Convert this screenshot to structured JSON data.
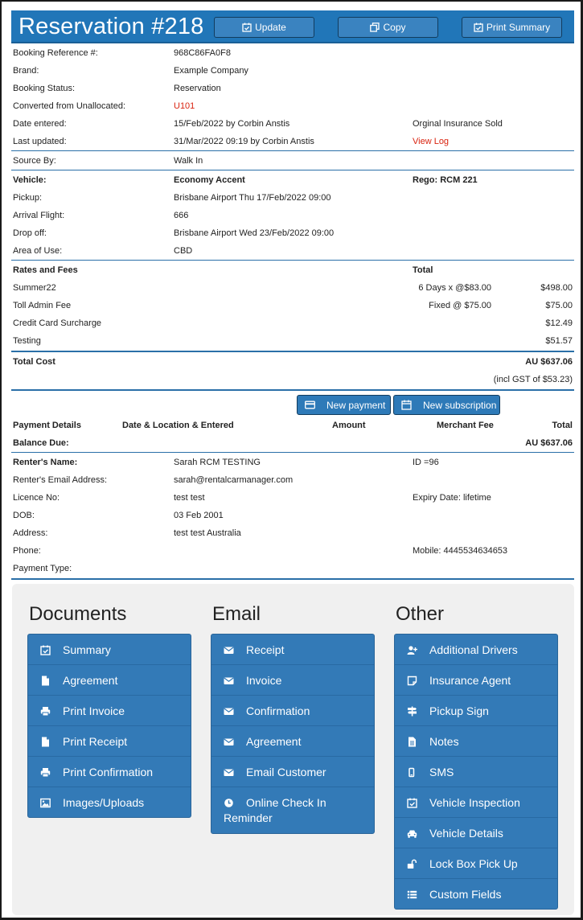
{
  "header": {
    "title": "Reservation #218",
    "update_label": "Update",
    "copy_label": "Copy",
    "print_summary_label": "Print Summary"
  },
  "booking": {
    "reference_label": "Booking Reference #:",
    "reference_value": "968C86FA0F8",
    "brand_label": "Brand:",
    "brand_value": "Example Company",
    "status_label": "Booking Status:",
    "status_value": "Reservation",
    "converted_label": "Converted from Unallocated:",
    "converted_value": "U101",
    "entered_label": "Date entered:",
    "entered_value": "15/Feb/2022 by Corbin Anstis",
    "insurance_note": "Orginal Insurance Sold",
    "updated_label": "Last updated:",
    "updated_value": "31/Mar/2022 09:19 by Corbin Anstis",
    "view_log": "View Log",
    "source_label": "Source By:",
    "source_value": "Walk In"
  },
  "vehicle": {
    "vehicle_label": "Vehicle:",
    "vehicle_value": "Economy Accent",
    "rego": "Rego: RCM 221",
    "pickup_label": "Pickup:",
    "pickup_value": "Brisbane Airport Thu 17/Feb/2022 09:00",
    "flight_label": "Arrival Flight:",
    "flight_value": "666",
    "dropoff_label": "Drop off:",
    "dropoff_value": "Brisbane Airport Wed 23/Feb/2022 09:00",
    "area_label": "Area of Use:",
    "area_value": "CBD"
  },
  "rates": {
    "heading": "Rates and Fees",
    "total_heading": "Total",
    "items": [
      {
        "name": "Summer22",
        "detail": "6 Days x @$83.00",
        "amount": "$498.00"
      },
      {
        "name": "Toll Admin Fee",
        "detail": "Fixed @ $75.00",
        "amount": "$75.00"
      },
      {
        "name": "Credit Card Surcharge",
        "detail": "",
        "amount": "$12.49"
      },
      {
        "name": "Testing",
        "detail": "",
        "amount": "$51.57"
      }
    ],
    "total_cost_label": "Total Cost",
    "total_cost_value": "AU $637.06",
    "gst_note": "(incl GST of $53.23)"
  },
  "payments": {
    "new_payment_label": "New payment",
    "new_subscription_label": "New subscription",
    "col_details": "Payment Details",
    "col_date": "Date & Location & Entered",
    "col_amount": "Amount",
    "col_fee": "Merchant Fee",
    "col_total": "Total",
    "balance_label": "Balance Due:",
    "balance_value": "AU $637.06"
  },
  "renter": {
    "name_label": "Renter's Name:",
    "name_value": "Sarah RCM TESTING",
    "id_value": "ID =96",
    "email_label": "Renter's Email Address:",
    "email_value": "sarah@rentalcarmanager.com",
    "licence_label": "Licence No:",
    "licence_value": "test test",
    "expiry_value": "Expiry Date: lifetime",
    "dob_label": "DOB:",
    "dob_value": "03 Feb 2001",
    "address_label": "Address:",
    "address_value": "test test Australia",
    "phone_label": "Phone:",
    "mobile_value": "Mobile: 4445534634653",
    "payment_type_label": "Payment Type:"
  },
  "documents": {
    "heading": "Documents",
    "items": [
      {
        "label": "Summary",
        "icon": "calendar-check-icon"
      },
      {
        "label": "Agreement",
        "icon": "file-icon"
      },
      {
        "label": "Print Invoice",
        "icon": "print-icon"
      },
      {
        "label": "Print Receipt",
        "icon": "file-icon"
      },
      {
        "label": "Print Confirmation",
        "icon": "print-icon"
      },
      {
        "label": "Images/Uploads",
        "icon": "image-icon"
      }
    ]
  },
  "email": {
    "heading": "Email",
    "items": [
      {
        "label": "Receipt",
        "icon": "envelope-icon"
      },
      {
        "label": "Invoice",
        "icon": "envelope-icon"
      },
      {
        "label": "Confirmation",
        "icon": "envelope-icon"
      },
      {
        "label": "Agreement",
        "icon": "envelope-icon"
      },
      {
        "label": "Email Customer",
        "icon": "envelope-icon"
      },
      {
        "label": "Online Check In",
        "label2": "Reminder",
        "icon": "clock-icon"
      }
    ]
  },
  "other": {
    "heading": "Other",
    "items": [
      {
        "label": "Additional Drivers",
        "icon": "user-plus-icon"
      },
      {
        "label": "Insurance Agent",
        "icon": "sticky-note-icon"
      },
      {
        "label": "Pickup Sign",
        "icon": "signpost-icon"
      },
      {
        "label": "Notes",
        "icon": "file-text-icon"
      },
      {
        "label": "SMS",
        "icon": "mobile-icon"
      },
      {
        "label": "Vehicle Inspection",
        "icon": "calendar-check-icon"
      },
      {
        "label": "Vehicle Details",
        "icon": "car-icon"
      },
      {
        "label": "Lock Box Pick Up",
        "icon": "unlock-icon"
      },
      {
        "label": "Custom Fields",
        "icon": "list-icon"
      }
    ]
  },
  "colors": {
    "header_bg": "#2176b8",
    "button_bg": "#337ab7",
    "panel_bg": "#f0f0f0",
    "link_red": "#d9230f"
  }
}
